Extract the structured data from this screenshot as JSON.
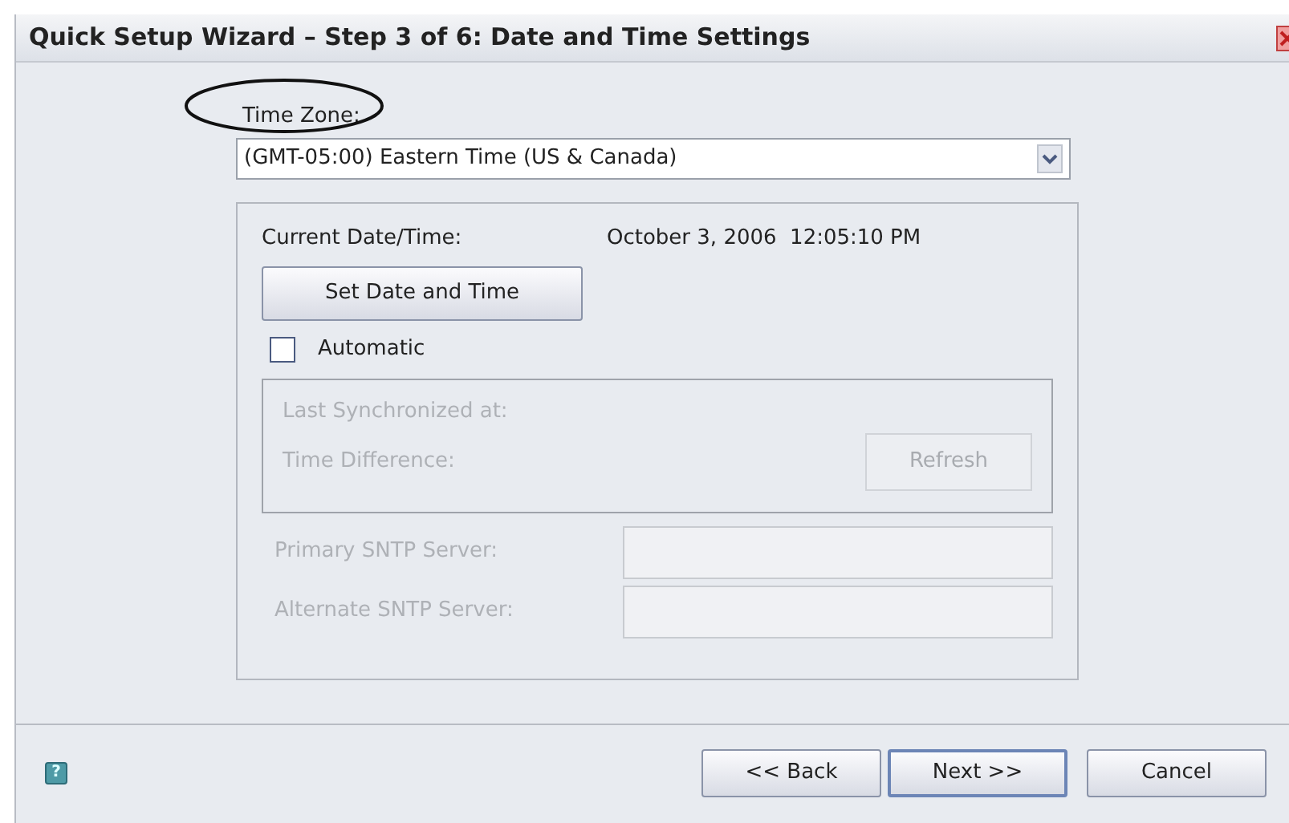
{
  "window": {
    "title": "Quick Setup Wizard – Step 3 of 6: Date and Time Settings"
  },
  "time_zone": {
    "label": "Time Zone:",
    "value": "(GMT-05:00) Eastern Time (US & Canada)",
    "highlighted": true
  },
  "current": {
    "label": "Current Date/Time:",
    "value": "October 3, 2006  12:05:10 PM"
  },
  "set_button": "Set Date and Time",
  "automatic": {
    "label": "Automatic",
    "checked": false
  },
  "sync": {
    "disabled": true,
    "last_label": "Last Synchronized at:",
    "diff_label": "Time Difference:",
    "refresh": "Refresh"
  },
  "servers": [
    {
      "label": "Primary SNTP Server:",
      "disabled": true
    },
    {
      "label": "Alternate SNTP Server:",
      "disabled": true
    }
  ],
  "help": "?",
  "buttons": [
    {
      "label": "<< Back",
      "default": false
    },
    {
      "label": "Next >>",
      "default": true
    },
    {
      "label": "Cancel",
      "default": false
    }
  ]
}
